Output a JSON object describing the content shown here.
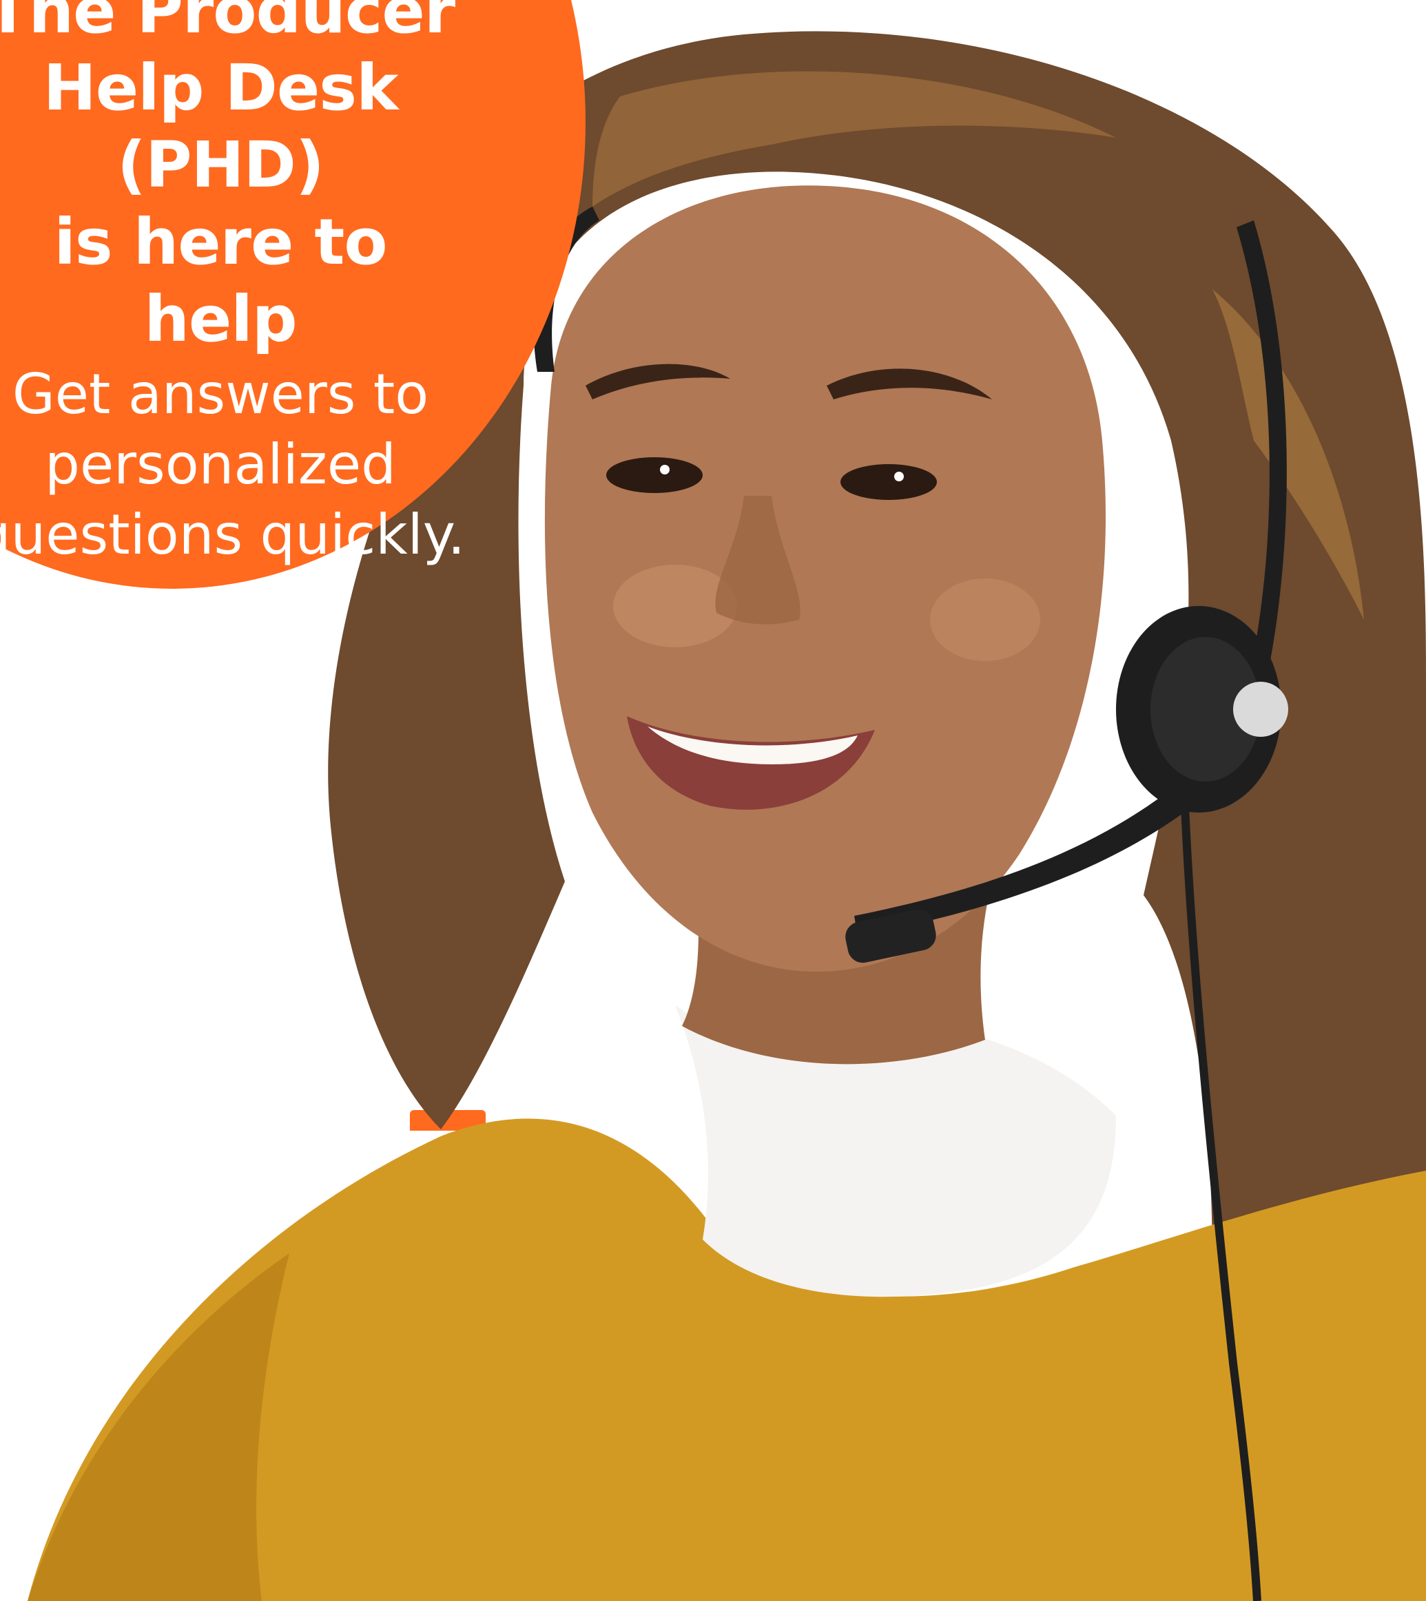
{
  "promo": {
    "headline_lines": [
      "The Producer",
      "Help Desk (PHD)",
      "is here to help"
    ],
    "subhead_lines": [
      "Get answers to",
      "personalized",
      "questions quickly."
    ]
  },
  "colors": {
    "brand_orange": "#FF6A1F",
    "hair": "#6E4A2E",
    "skin": "#B07855",
    "sweater": "#D39A23",
    "collar": "#F5F3F1",
    "headset": "#1E1E1E"
  }
}
